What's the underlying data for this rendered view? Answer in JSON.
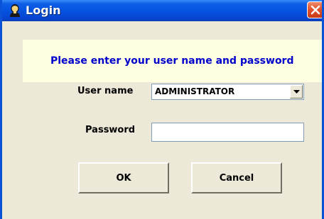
{
  "window": {
    "title": "Login",
    "icon": "user-icon",
    "close_icon": "close-icon"
  },
  "banner": {
    "message": "Please enter your user name and password"
  },
  "form": {
    "username_label": "User name",
    "username_value": "ADMINISTRATOR",
    "password_label": "Password",
    "password_value": ""
  },
  "buttons": {
    "ok_label": "OK",
    "cancel_label": "Cancel"
  },
  "colors": {
    "titlebar": "#0553e0",
    "banner_bg": "#ffffe1",
    "banner_text": "#0000cc",
    "dialog_bg": "#ece9d8",
    "close_button": "#e0502a"
  }
}
